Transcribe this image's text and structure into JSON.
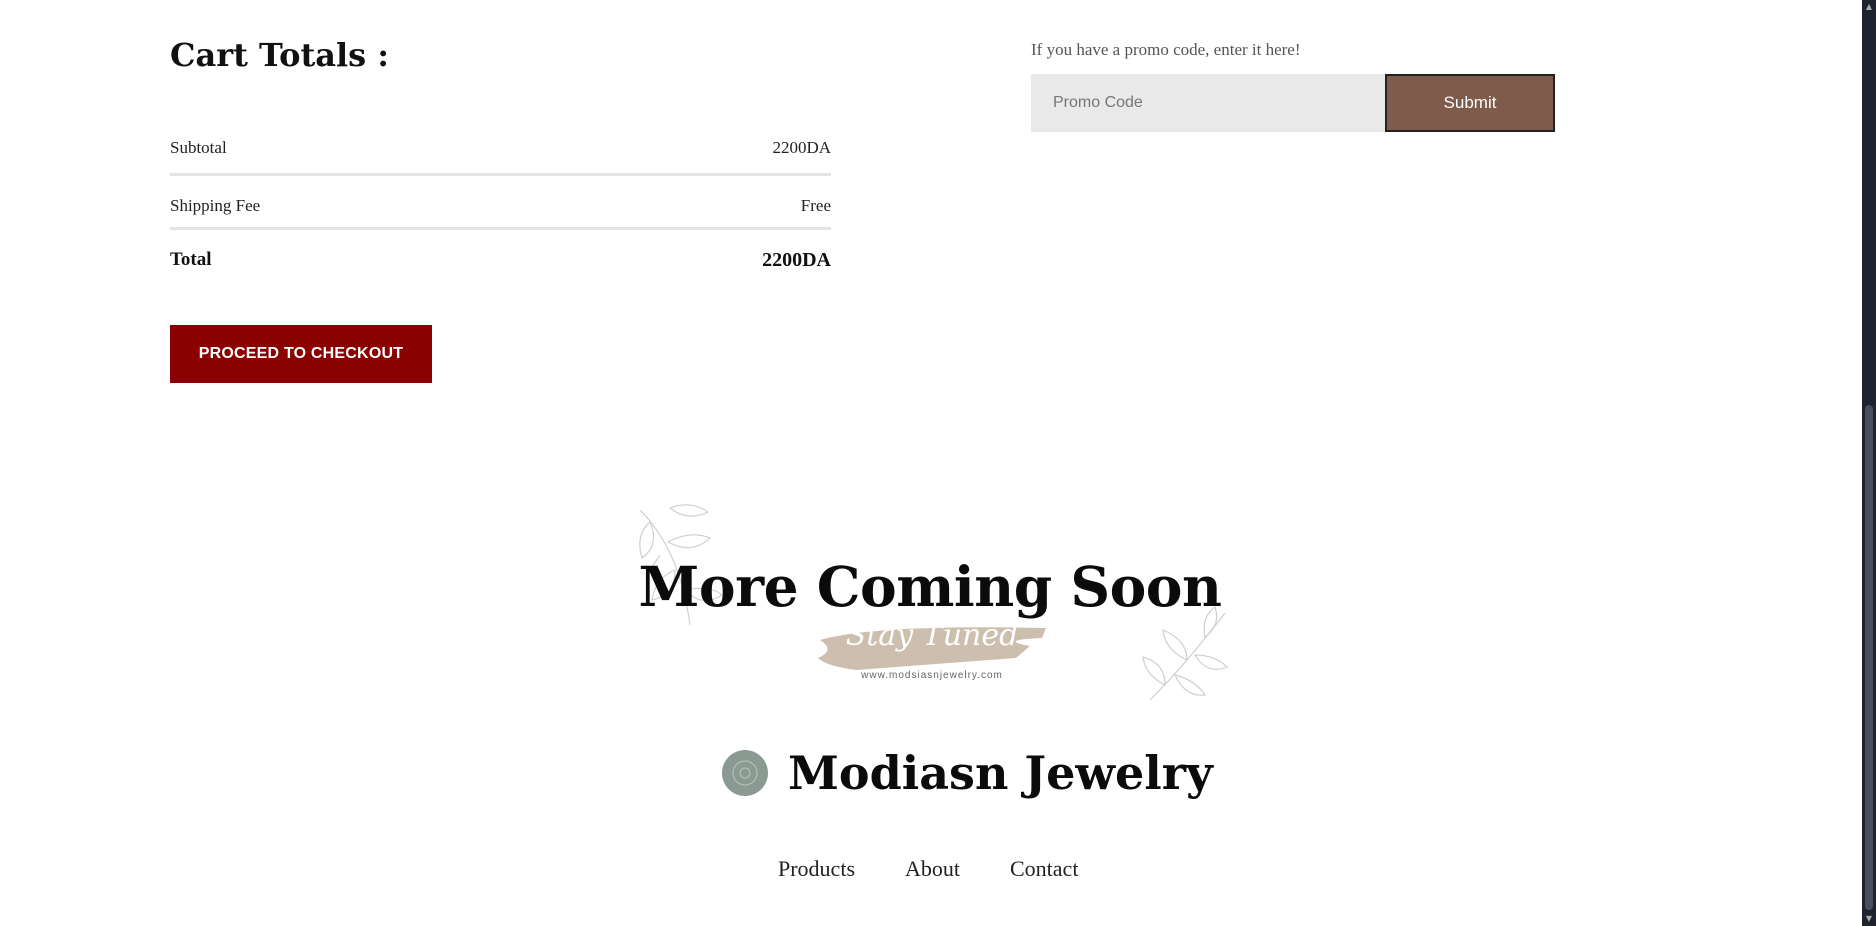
{
  "cart": {
    "title": "Cart Totals :",
    "rows": [
      {
        "label": "Subtotal",
        "value": "2200DA"
      },
      {
        "label": "Shipping Fee",
        "value": "Free"
      },
      {
        "label": "Total",
        "value": "2200DA"
      }
    ],
    "checkout_label": "PROCEED TO CHECKOUT"
  },
  "promo": {
    "hint": "If you have a promo code, enter it here!",
    "placeholder": "Promo Code",
    "submit_label": "Submit"
  },
  "banner": {
    "title": "More Coming Soon",
    "tagline": "Stay Tuned",
    "url": "www.modsiasnjewelry.com"
  },
  "brand": {
    "name": "Modiasn Jewelry",
    "logo_icon": "jewelry-logo-icon"
  },
  "footer": {
    "links": [
      {
        "label": "Products"
      },
      {
        "label": "About"
      },
      {
        "label": "Contact"
      }
    ]
  },
  "colors": {
    "checkout_bg": "#8b0000",
    "submit_bg": "#7e5b4b",
    "input_bg": "#e9e9e9",
    "brush": "#cdbfae",
    "scrollbar": "#1f2330"
  }
}
